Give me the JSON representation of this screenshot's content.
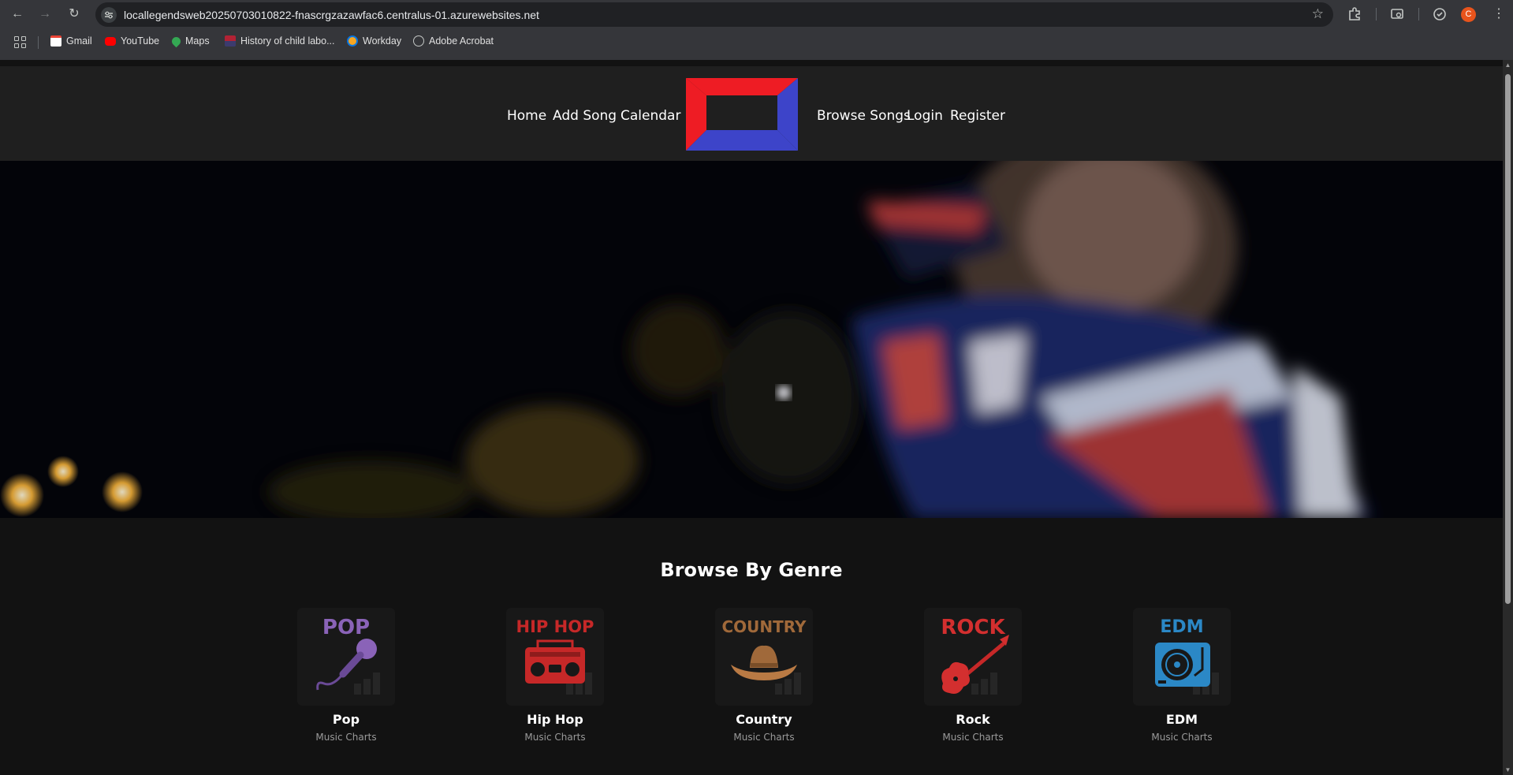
{
  "browser": {
    "url": "locallegendsweb20250703010822-fnascrgzazawfac6.centralus-01.azurewebsites.net",
    "profile_initial": "C",
    "bookmarks": [
      {
        "label": "Gmail",
        "icon": "gmail-icon",
        "color": "#ea4335"
      },
      {
        "label": "YouTube",
        "icon": "youtube-icon",
        "color": "#ff0000"
      },
      {
        "label": "Maps",
        "icon": "maps-icon",
        "color": "#34a853"
      },
      {
        "label": "History of child labo...",
        "icon": "flag-icon",
        "color": "#b22234"
      },
      {
        "label": "Workday",
        "icon": "workday-icon",
        "color": "#f5a623"
      },
      {
        "label": "Adobe Acrobat",
        "icon": "globe-icon",
        "color": "#c4c7c5"
      }
    ]
  },
  "nav": {
    "home": "Home",
    "add_song": "Add Song",
    "calendar": "Calendar",
    "browse_songs": "Browse Songs",
    "login": "Login",
    "register": "Register"
  },
  "logo": {
    "primary_color": "#ee1c24",
    "secondary_color": "#3d44c9"
  },
  "browse": {
    "title": "Browse By Genre",
    "genres": [
      {
        "name": "Pop",
        "subtitle": "Music Charts",
        "tile_text": "POP",
        "tile_color": "#8a63b8",
        "icon": "microphone-icon"
      },
      {
        "name": "Hip Hop",
        "subtitle": "Music Charts",
        "tile_text": "HIP HOP",
        "tile_color": "#c62828",
        "icon": "boombox-icon"
      },
      {
        "name": "Country",
        "subtitle": "Music Charts",
        "tile_text": "COUNTRY",
        "tile_color": "#a0693a",
        "icon": "cowboy-hat-icon"
      },
      {
        "name": "Rock",
        "subtitle": "Music Charts",
        "tile_text": "ROCK",
        "tile_color": "#d32f2f",
        "icon": "electric-guitar-icon"
      },
      {
        "name": "EDM",
        "subtitle": "Music Charts",
        "tile_text": "EDM",
        "tile_color": "#2b88c6",
        "icon": "turntable-icon"
      }
    ]
  }
}
